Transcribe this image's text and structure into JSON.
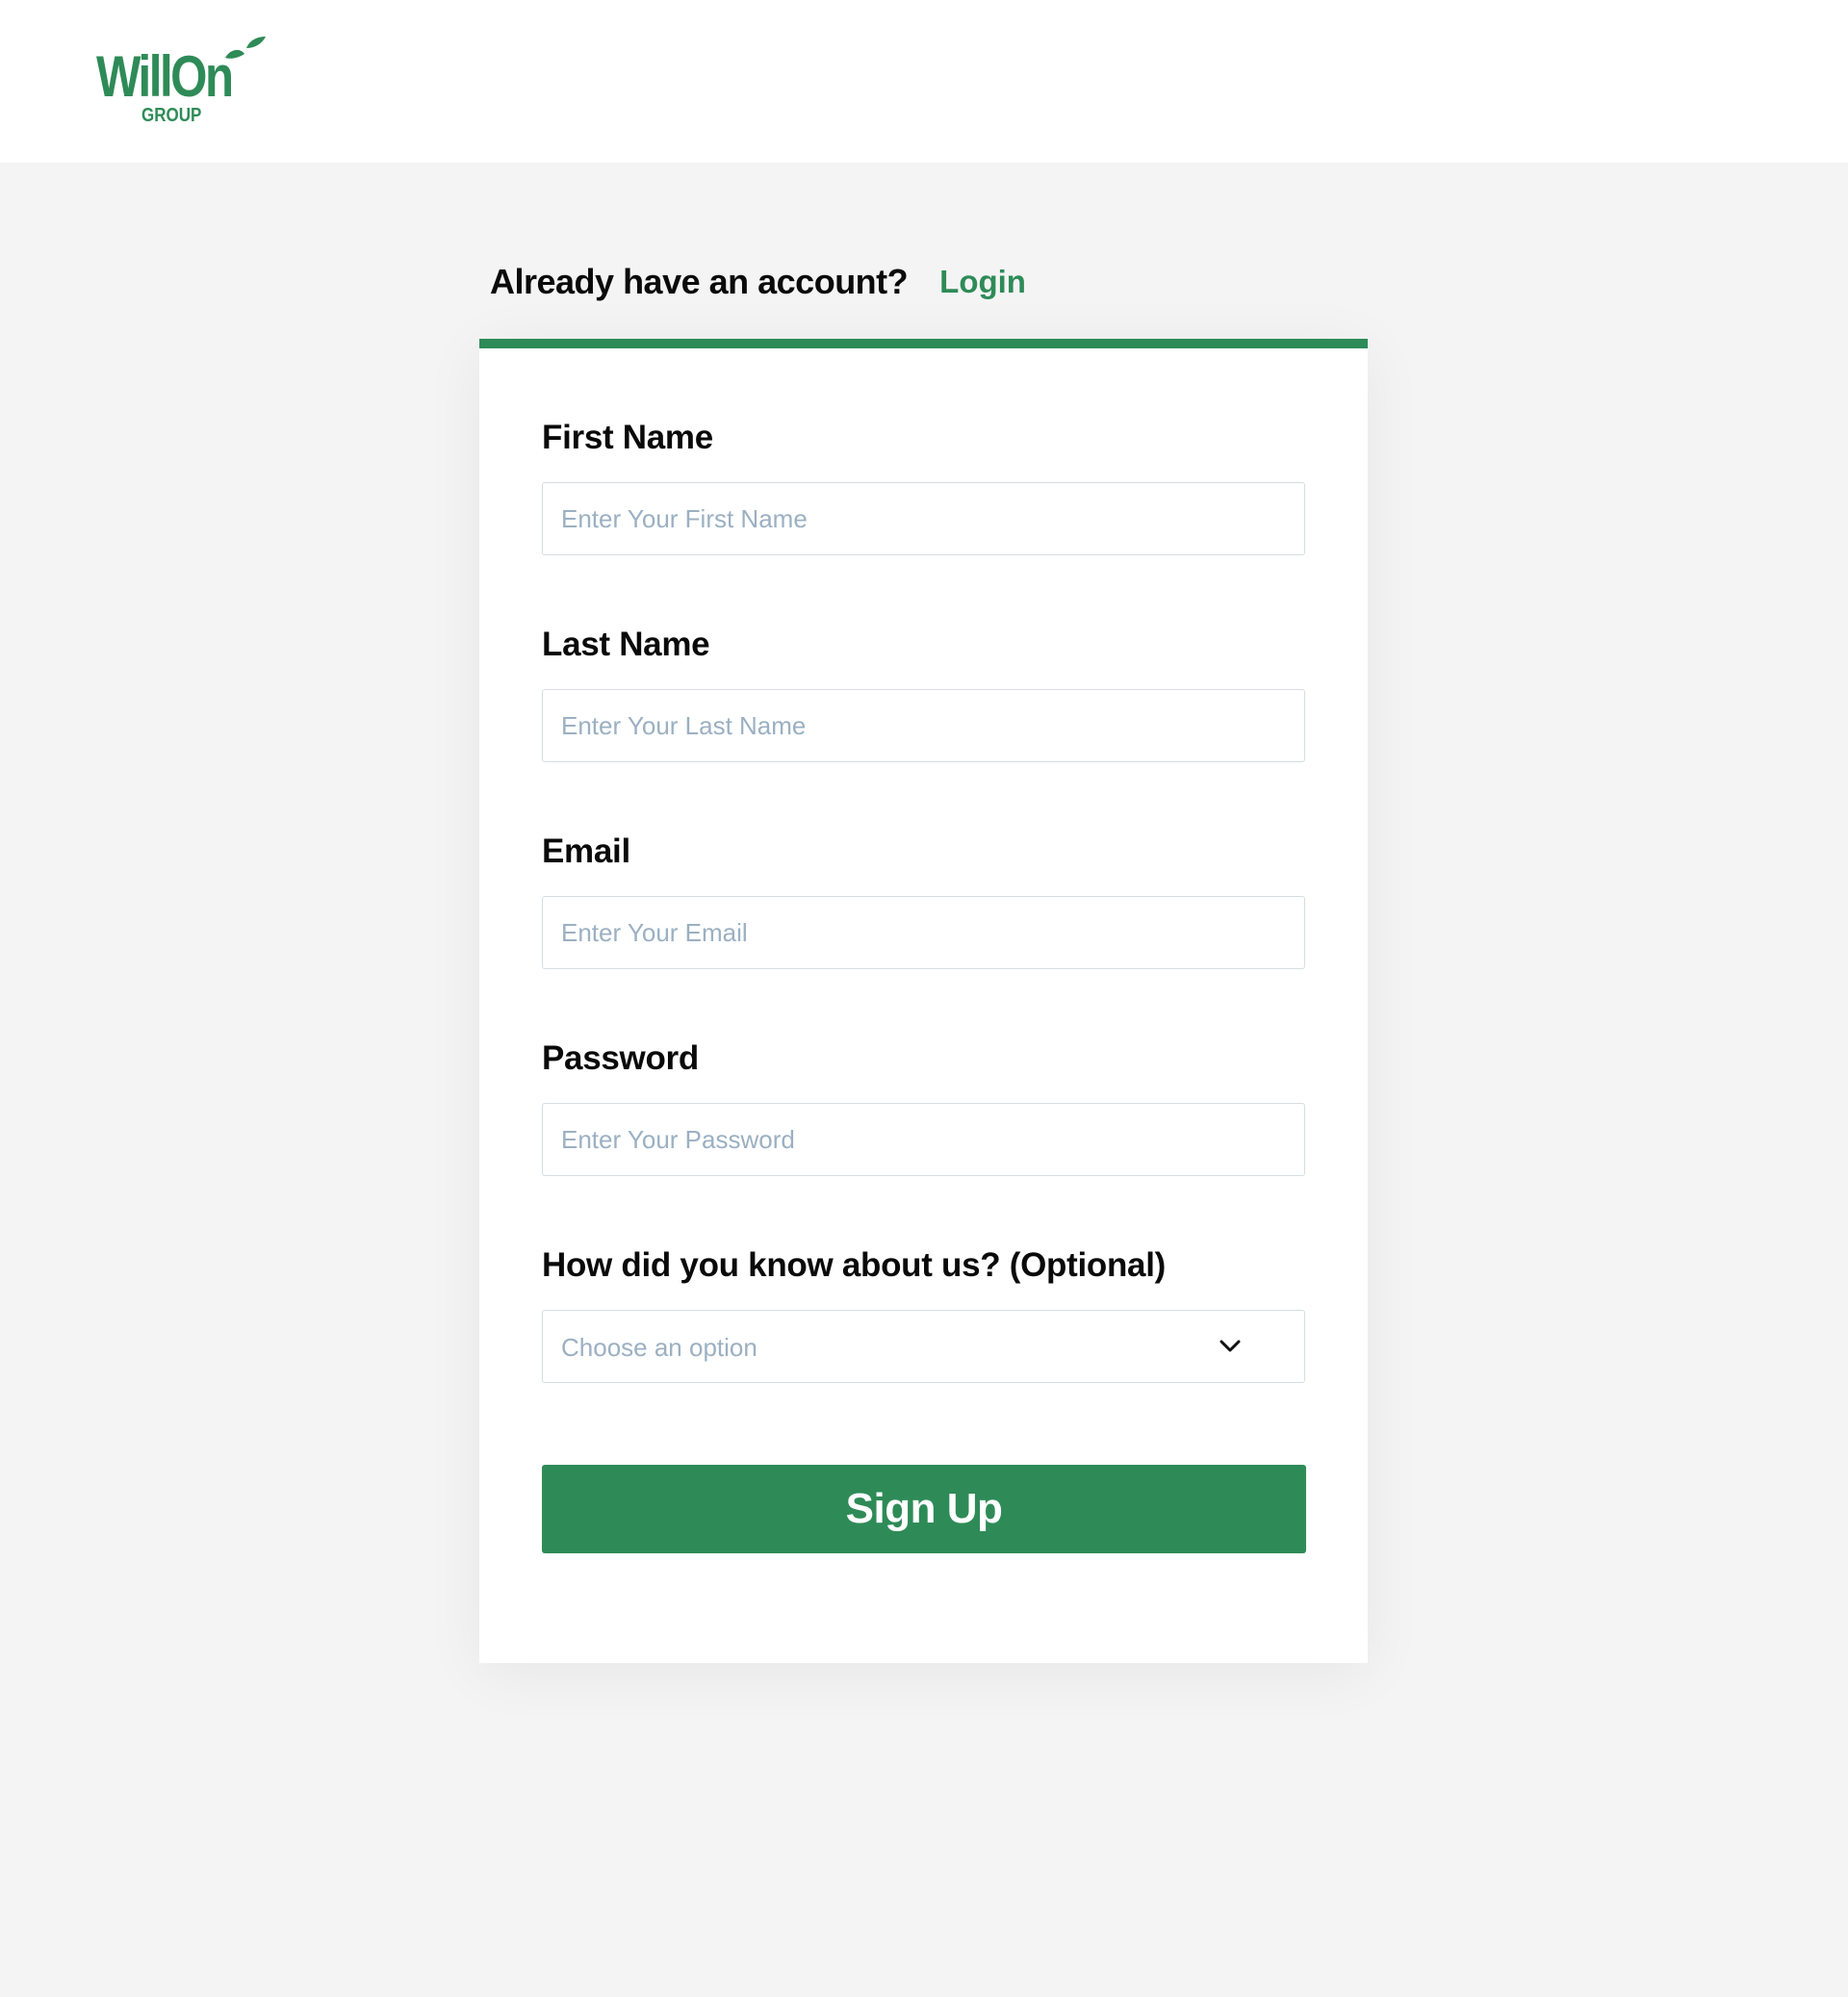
{
  "brand": {
    "name": "WillOn",
    "subtitle": "GROUP",
    "color": "#2e8b57"
  },
  "account_prompt": {
    "question": "Already have an account?",
    "login_label": "Login"
  },
  "form": {
    "accent_color": "#2e8b57",
    "first_name": {
      "label": "First Name",
      "placeholder": "Enter Your First Name",
      "value": ""
    },
    "last_name": {
      "label": "Last Name",
      "placeholder": "Enter Your Last Name",
      "value": ""
    },
    "email": {
      "label": "Email",
      "placeholder": "Enter Your Email",
      "value": ""
    },
    "password": {
      "label": "Password",
      "placeholder": "Enter Your Password",
      "value": ""
    },
    "referral": {
      "label": "How did you know about us?  (Optional)",
      "selected": "Choose an option",
      "icon": "chevron-down-icon"
    },
    "submit_label": "Sign Up"
  }
}
